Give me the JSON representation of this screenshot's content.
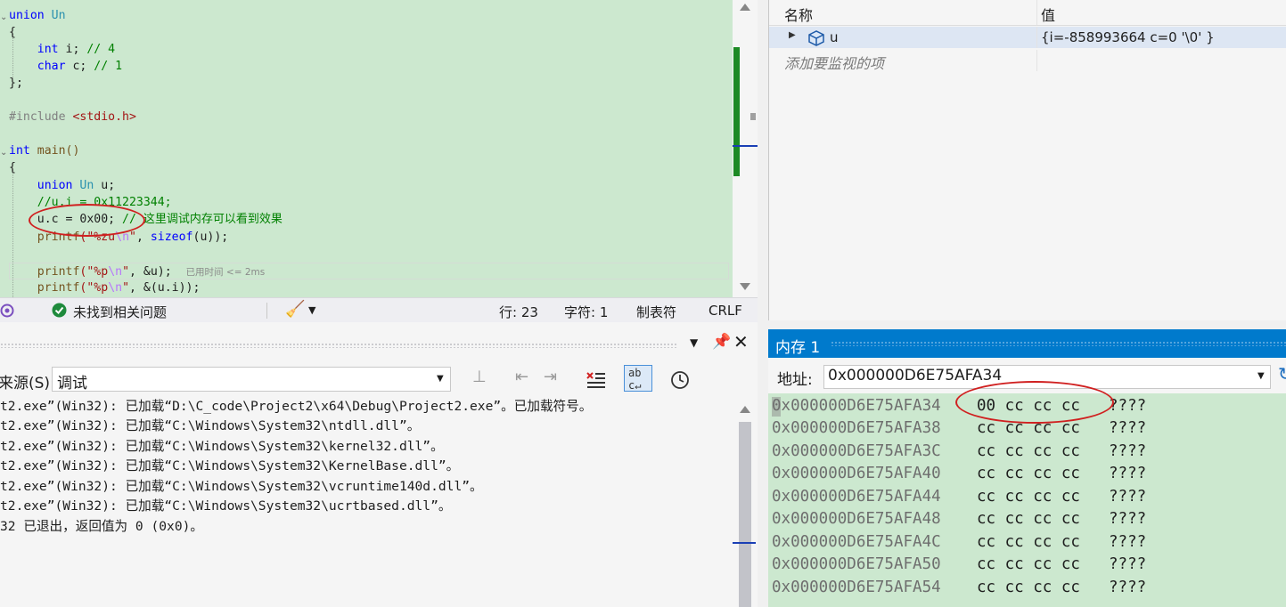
{
  "editor": {
    "lines": [
      {
        "kind": "union-decl",
        "k1": "union",
        "name": "Un"
      },
      {
        "kind": "text",
        "text": "{"
      },
      {
        "kind": "member",
        "type": "int",
        "rest": " i; ",
        "comment": "// 4"
      },
      {
        "kind": "member",
        "type": "char",
        "rest": " c; ",
        "comment": "// 1"
      },
      {
        "kind": "text",
        "text": "};"
      },
      {
        "kind": "blank"
      },
      {
        "kind": "include",
        "directive": "#include ",
        "header": "<stdio.h>"
      },
      {
        "kind": "blank"
      },
      {
        "kind": "main",
        "type": "int",
        "rest": " main()"
      },
      {
        "kind": "text",
        "text": "{"
      },
      {
        "kind": "var",
        "k1": "union",
        "name": "Un",
        "rest": " u;"
      },
      {
        "kind": "comment",
        "text": "//u.i = 0x11223344;"
      },
      {
        "kind": "assign",
        "code": "u.c = 0x00; ",
        "comment": "// ",
        "comment_cn": "这里调试内存可以看到效果"
      },
      {
        "kind": "printf1",
        "f": "printf",
        "a": "(\"",
        "s1": "%zu",
        "esc": "\\n",
        "s2": "\"",
        "b": ", ",
        "kw": "sizeof",
        "c": "(u));"
      },
      {
        "kind": "blank"
      },
      {
        "kind": "printf2",
        "f": "printf",
        "a": "(\"",
        "s1": "%p",
        "esc": "\\n",
        "s2": "\"",
        "b": ", &u);",
        "hint": "已用时间 <= 2ms"
      },
      {
        "kind": "printf3",
        "f": "printf",
        "a": "(\"",
        "s1": "%p",
        "esc": "\\n",
        "s2": "\"",
        "b": ", &(u.i));"
      }
    ]
  },
  "editor_status": {
    "issues": "未找到相关问题",
    "line": "行: 23",
    "char": "字符: 1",
    "tabs": "制表符",
    "eol": "CRLF"
  },
  "watch": {
    "col_name": "名称",
    "col_value": "值",
    "rows": [
      {
        "name": "u",
        "value": "{i=-858993664 c=0 '\\0' }"
      }
    ],
    "add_hint": "添加要监视的项"
  },
  "output": {
    "source_label": "来源(S):",
    "source_value": "调试",
    "lines": [
      "t2.exe”(Win32): 已加载“D:\\C_code\\Project2\\x64\\Debug\\Project2.exe”。已加载符号。",
      "t2.exe”(Win32): 已加载“C:\\Windows\\System32\\ntdll.dll”。",
      "t2.exe”(Win32): 已加载“C:\\Windows\\System32\\kernel32.dll”。",
      "t2.exe”(Win32): 已加载“C:\\Windows\\System32\\KernelBase.dll”。",
      "t2.exe”(Win32): 已加载“C:\\Windows\\System32\\vcruntime140d.dll”。",
      "t2.exe”(Win32): 已加载“C:\\Windows\\System32\\ucrtbased.dll”。",
      "32 已退出，返回值为 0 (0x0)。"
    ]
  },
  "memory": {
    "title": "内存 1",
    "address_label": "地址:",
    "address_value": "0x000000D6E75AFA34",
    "rows": [
      {
        "addr": "0x000000D6E75AFA34",
        "bytes": "00 cc cc cc",
        "chars": "????"
      },
      {
        "addr": "0x000000D6E75AFA38",
        "bytes": "cc cc cc cc",
        "chars": "????"
      },
      {
        "addr": "0x000000D6E75AFA3C",
        "bytes": "cc cc cc cc",
        "chars": "????"
      },
      {
        "addr": "0x000000D6E75AFA40",
        "bytes": "cc cc cc cc",
        "chars": "????"
      },
      {
        "addr": "0x000000D6E75AFA44",
        "bytes": "cc cc cc cc",
        "chars": "????"
      },
      {
        "addr": "0x000000D6E75AFA48",
        "bytes": "cc cc cc cc",
        "chars": "????"
      },
      {
        "addr": "0x000000D6E75AFA4C",
        "bytes": "cc cc cc cc",
        "chars": "????"
      },
      {
        "addr": "0x000000D6E75AFA50",
        "bytes": "cc cc cc cc",
        "chars": "????"
      },
      {
        "addr": "0x000000D6E75AFA54",
        "bytes": "cc cc cc cc",
        "chars": "????"
      }
    ]
  },
  "colors": {
    "editor_bg": "#cce8cf",
    "accent": "#007acc",
    "annotation": "#d02020",
    "keyword": "#0000ff",
    "type": "#2b91af",
    "comment": "#008000"
  }
}
